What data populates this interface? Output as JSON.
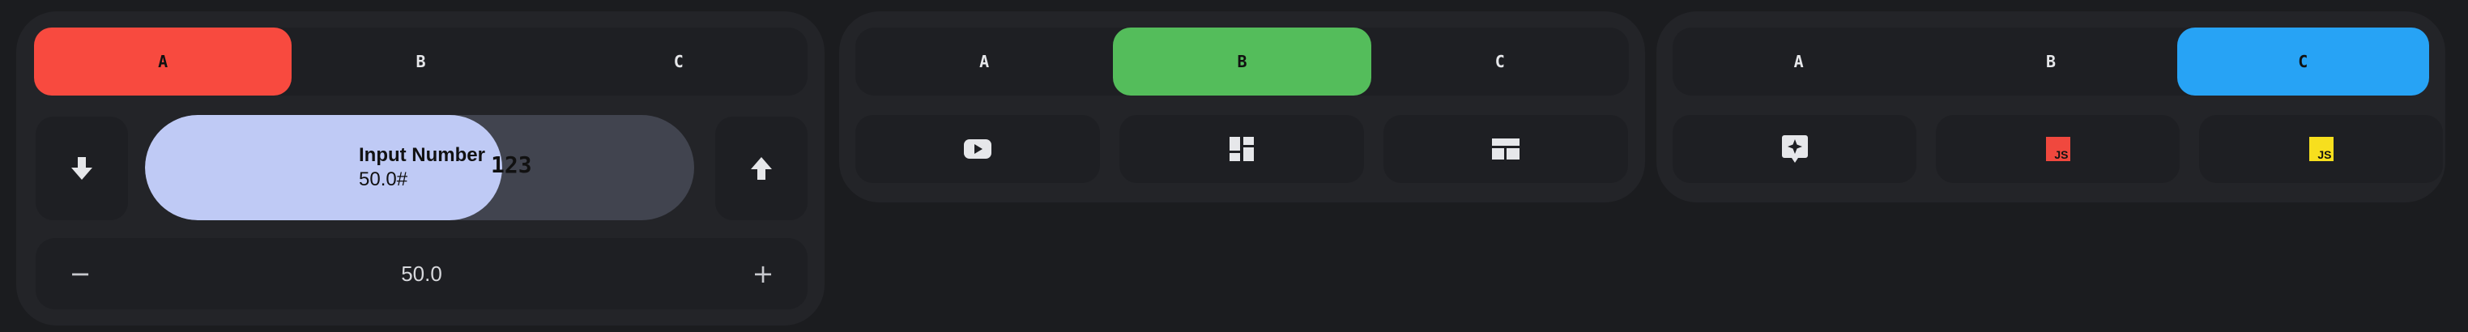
{
  "colors": {
    "background": "#1b1c1f",
    "panel": "#232428",
    "tile": "#1e1f23",
    "active_red": "#f84a3f",
    "active_green": "#54bd5b",
    "active_blue": "#27a3f5",
    "slider_fill": "#bfcaf5",
    "slider_track": "#41444f",
    "js_red": "#f0483e",
    "js_yellow": "#f7df1e"
  },
  "panels": [
    {
      "segments": [
        {
          "label": "A",
          "active": true
        },
        {
          "label": "B",
          "active": false
        },
        {
          "label": "C",
          "active": false
        }
      ],
      "down_icon": "arrow-down-icon",
      "up_icon": "arrow-up-icon",
      "slider": {
        "title": "Input Number",
        "value_text": "50.0#",
        "badge": "123",
        "fraction": 0.65
      },
      "stepper": {
        "minus": "−",
        "value": "50.0",
        "plus": "+"
      }
    },
    {
      "segments": [
        {
          "label": "A",
          "active": false
        },
        {
          "label": "B",
          "active": true
        },
        {
          "label": "C",
          "active": false
        }
      ],
      "icons": [
        "youtube-icon",
        "dashboard-icon",
        "layout-icon"
      ]
    },
    {
      "segments": [
        {
          "label": "A",
          "active": false
        },
        {
          "label": "B",
          "active": false
        },
        {
          "label": "C",
          "active": true
        }
      ],
      "icons": [
        "sparkle-chat-icon",
        "javascript-red-icon",
        "javascript-yellow-icon"
      ],
      "js_text": "JS"
    }
  ]
}
